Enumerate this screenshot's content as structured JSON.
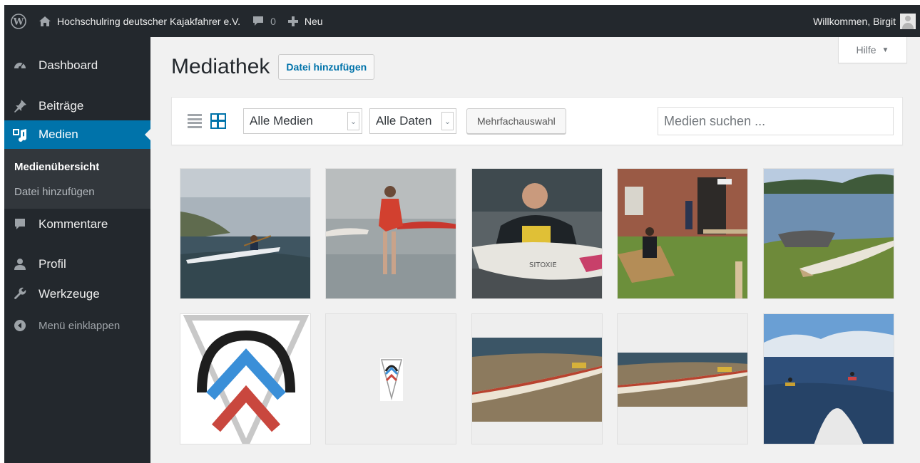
{
  "adminbar": {
    "site_name": "Hochschulring deutscher Kajakfahrer e.V.",
    "comments_count": "0",
    "new_label": "Neu",
    "greeting": "Willkommen, Birgit"
  },
  "sidebar": {
    "items": [
      {
        "label": "Dashboard",
        "icon": "dashboard-icon"
      },
      {
        "label": "Beiträge",
        "icon": "pin-icon"
      },
      {
        "label": "Medien",
        "icon": "media-icon"
      },
      {
        "label": "Kommentare",
        "icon": "comment-icon"
      },
      {
        "label": "Profil",
        "icon": "user-icon"
      },
      {
        "label": "Werkzeuge",
        "icon": "wrench-icon"
      }
    ],
    "submenu": [
      "Medienübersicht",
      "Datei hinzufügen"
    ],
    "collapse_label": "Menü einklappen"
  },
  "header": {
    "help_label": "Hilfe",
    "title": "Mediathek",
    "add_button": "Datei hinzufügen"
  },
  "toolbar": {
    "filter_media": "Alle Medien",
    "filter_dates": "Alle Daten",
    "bulk_select": "Mehrfachauswahl",
    "search_placeholder": "Medien suchen ..."
  },
  "media_items": [
    {
      "type": "photo",
      "subject": "kayaker-on-water"
    },
    {
      "type": "photo",
      "subject": "person-in-red-with-kayak"
    },
    {
      "type": "photo",
      "subject": "kayaker-close-up"
    },
    {
      "type": "photo",
      "subject": "boat-building-outdoors"
    },
    {
      "type": "photo",
      "subject": "kayak-on-shore"
    },
    {
      "type": "image",
      "subject": "club-logo-large"
    },
    {
      "type": "image",
      "subject": "club-logo-small"
    },
    {
      "type": "photo",
      "subject": "kayak-on-sand"
    },
    {
      "type": "photo",
      "subject": "kayak-on-sand-wide"
    },
    {
      "type": "photo",
      "subject": "kayak-trip-at-sea"
    }
  ],
  "colors": {
    "accent": "#0073aa",
    "adminbar_bg": "#23282d",
    "page_bg": "#f1f1f1"
  }
}
